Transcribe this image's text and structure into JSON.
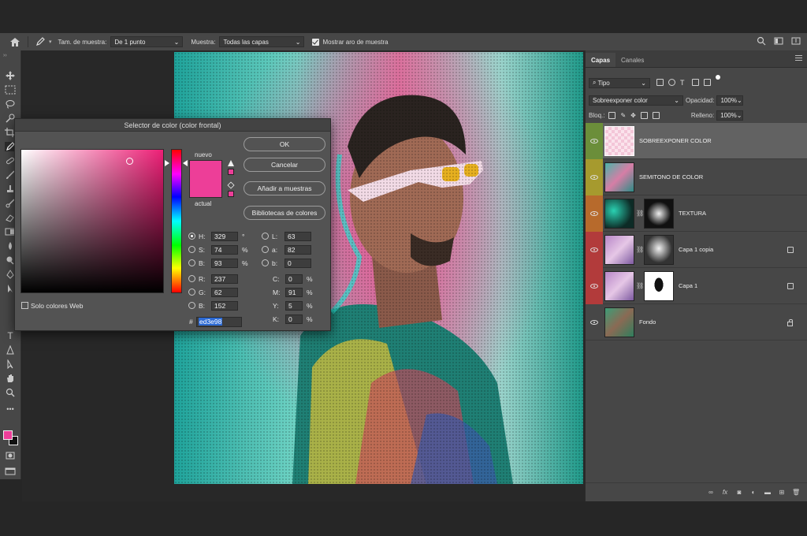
{
  "options_bar": {
    "sample_size_label": "Tam. de muestra:",
    "sample_size_value": "De 1 punto",
    "sample_label": "Muestra:",
    "sample_value": "Todas las capas",
    "show_ring_label": "Mostrar aro de muestra",
    "show_ring_checked": true
  },
  "color_picker": {
    "title": "Selector de color (color frontal)",
    "new_label": "nuevo",
    "current_label": "actual",
    "new_color": "#ed3e98",
    "current_color": "#ed3e98",
    "ok_button": "OK",
    "cancel_button": "Cancelar",
    "add_to_swatches_button": "Añadir a muestras",
    "color_libraries_button": "Bibliotecas de colores",
    "web_colors_only_label": "Solo colores Web",
    "hsb": {
      "h_label": "H:",
      "h": "329",
      "h_unit": "°",
      "s_label": "S:",
      "s": "74",
      "s_unit": "%",
      "b_label": "B:",
      "b": "93",
      "b_unit": "%"
    },
    "rgb": {
      "r_label": "R:",
      "r": "237",
      "g_label": "G:",
      "g": "62",
      "b_label": "B:",
      "b": "152"
    },
    "lab": {
      "l_label": "L:",
      "l": "63",
      "a_label": "a:",
      "a": "82",
      "b_label": "b:",
      "b": "0"
    },
    "cmyk": {
      "c_label": "C:",
      "c": "0",
      "m_label": "M:",
      "m": "91",
      "y_label": "Y:",
      "y": "5",
      "k_label": "K:",
      "k": "0",
      "unit": "%"
    },
    "hex_label": "#",
    "hex": "ed3e98"
  },
  "layers_panel": {
    "tabs": [
      "Capas",
      "Canales"
    ],
    "filter_value": "Tipo",
    "blend_mode": "Sobreexponer color",
    "opacity_label": "Opacidad:",
    "opacity_value": "100%",
    "lock_label": "Bloq.:",
    "fill_label": "Relleno:",
    "fill_value": "100%",
    "layers": [
      {
        "name": "SOBREEXPONER COLOR",
        "color_tag": "#6b8e3a",
        "selected": true
      },
      {
        "name": "SEMITONO DE COLOR",
        "color_tag": "#a69a2e",
        "selected": false
      },
      {
        "name": "TEXTURA",
        "color_tag": "#b76a2c",
        "selected": false
      },
      {
        "name": "Capa 1 copia",
        "color_tag": "#b23b3b",
        "selected": false
      },
      {
        "name": "Capa 1",
        "color_tag": "#b23b3b",
        "selected": false
      },
      {
        "name": "Fondo",
        "color_tag": "",
        "selected": false
      }
    ],
    "footer_fx": "fx"
  },
  "toolbar": {
    "foreground_color": "#ed3e98",
    "background_color": "#111111"
  }
}
